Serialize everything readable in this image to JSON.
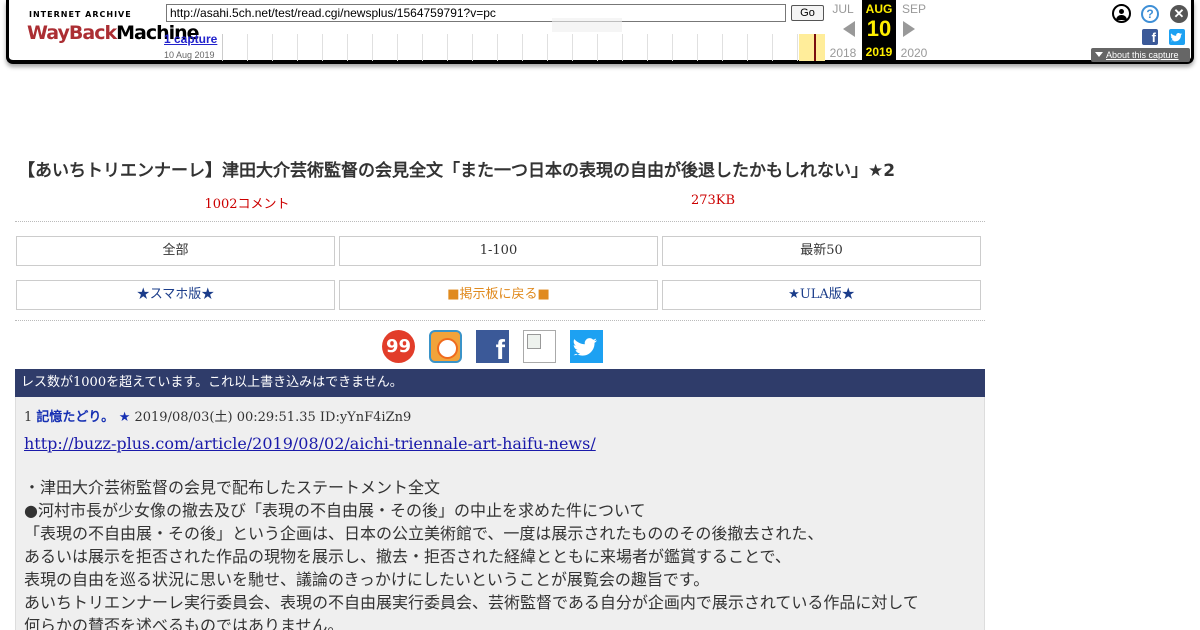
{
  "wayback": {
    "logo_top": "INTERNET ARCHIVE",
    "logo_main_1": "WayBack",
    "logo_main_2": "Machine",
    "url": "http://asahi.5ch.net/test/read.cgi/newsplus/1564759791?v=pc",
    "go_label": "Go",
    "captures_label": "1 capture",
    "capture_date": "10 Aug 2019",
    "prev_month": "JUL",
    "current_month": "AUG",
    "current_day": "10",
    "next_month": "SEP",
    "prev_year": "2018",
    "current_year": "2019",
    "next_year": "2020",
    "about_label": "About this capture",
    "icons": [
      "user-icon",
      "help-icon",
      "close-icon",
      "facebook-icon",
      "twitter-icon"
    ]
  },
  "thread": {
    "title": "【あいちトリエンナーレ】津田大介芸術監督の会見全文「また一つ日本の表現の自由が後退したかもしれない」★2",
    "comment_count": "1002コメント",
    "size": "273KB"
  },
  "nav": {
    "all": "全部",
    "range": "1-100",
    "latest": "最新50",
    "smartphone": "★スマホ版★",
    "back_to_board": "■掲示板に戻る■",
    "ula": "★ULA版★"
  },
  "share_icons": [
    "99-icon",
    "app-icon",
    "facebook-icon",
    "broken-image-icon",
    "twitter-icon"
  ],
  "notice": "レス数が1000を超えています。これ以上書き込みはできません。",
  "post": {
    "number": "1",
    "name": "記憶たどり。 ★",
    "datetime": "2019/08/03(土) 00:29:51.35 ID:yYnF4iZn9",
    "link": "http://buzz-plus.com/article/2019/08/02/aichi-triennale-art-haifu-news/",
    "body_lines": [
      "・津田大介芸術監督の会見で配布したステートメント全文",
      "●河村市長が少女像の撤去及び「表現の不自由展・その後」の中止を求めた件について",
      "「表現の不自由展・その後」という企画は、日本の公立美術館で、一度は展示されたもののその後撤去された、",
      "あるいは展示を拒否された作品の現物を展示し、撤去・拒否された経緯とともに来場者が鑑賞することで、",
      "表現の自由を巡る状況に思いを馳せ、議論のきっかけにしたいということが展覧会の趣旨です。",
      "あいちトリエンナーレ実行委員会、表現の不自由展実行委員会、芸術監督である自分が企画内で展示されている作品に対して",
      "何らかの賛否を述べるものではありません。"
    ]
  },
  "colors": {
    "notice_bg": "#2f3c6a",
    "post_bg": "#efefef",
    "meta_red": "#cc0000",
    "name_blue": "#1630b3",
    "wayback_highlight": "#ffee00"
  }
}
